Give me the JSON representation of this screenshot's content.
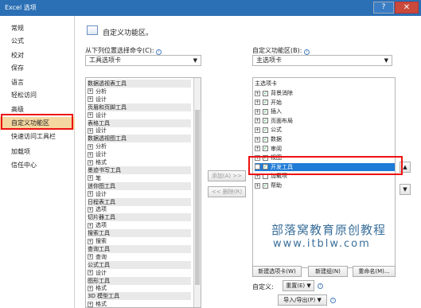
{
  "window": {
    "title": "Excel 选项",
    "help": "?",
    "close": "✕"
  },
  "sidebar": {
    "items": [
      {
        "label": "常规"
      },
      {
        "label": "公式"
      },
      {
        "label": "校对"
      },
      {
        "label": "保存"
      },
      {
        "label": "语言"
      },
      {
        "label": "轻松访问"
      },
      {
        "label": "高级"
      },
      {
        "label": "自定义功能区"
      },
      {
        "label": "快速访问工具栏"
      },
      {
        "label": "加载项"
      },
      {
        "label": "信任中心"
      }
    ],
    "selected": "自定义功能区"
  },
  "main": {
    "title": "自定义功能区。",
    "left_label": "从下列位置选择命令(C):",
    "left_combo": "工具选项卡",
    "right_label": "自定义功能区(B):",
    "right_combo": "主选项卡",
    "left_list": [
      {
        "text": "数据透视表工具",
        "group": true
      },
      {
        "text": "分析",
        "pm": "⊞"
      },
      {
        "text": "设计",
        "pm": "⊞"
      },
      {
        "text": "页眉和页脚工具",
        "group": true
      },
      {
        "text": "设计",
        "pm": "⊞"
      },
      {
        "text": "表格工具",
        "group": true
      },
      {
        "text": "设计",
        "pm": "⊞"
      },
      {
        "text": "数据透视图工具",
        "group": true
      },
      {
        "text": "分析",
        "pm": "⊞"
      },
      {
        "text": "设计",
        "pm": "⊞"
      },
      {
        "text": "格式",
        "pm": "⊞"
      },
      {
        "text": "墨迹书写工具",
        "group": true
      },
      {
        "text": "笔",
        "pm": "⊞"
      },
      {
        "text": "迷你图工具",
        "group": true
      },
      {
        "text": "设计",
        "pm": "⊞"
      },
      {
        "text": "日程表工具",
        "group": true
      },
      {
        "text": "选项",
        "pm": "⊞"
      },
      {
        "text": "切片器工具",
        "group": true
      },
      {
        "text": "选项",
        "pm": "⊞"
      },
      {
        "text": "搜索工具",
        "group": true
      },
      {
        "text": "搜索",
        "pm": "⊞"
      },
      {
        "text": "查询工具",
        "group": true
      },
      {
        "text": "查询",
        "pm": "⊞"
      },
      {
        "text": "公式工具",
        "group": true
      },
      {
        "text": "设计",
        "pm": "⊞"
      },
      {
        "text": "图形工具",
        "group": true
      },
      {
        "text": "格式",
        "pm": "⊞"
      },
      {
        "text": "3D 模型工具",
        "group": true
      },
      {
        "text": "格式",
        "pm": "⊞"
      }
    ],
    "right_list_header": "主选项卡",
    "right_list": [
      {
        "text": "背景消除",
        "checked": true
      },
      {
        "text": "开始",
        "checked": true
      },
      {
        "text": "插入",
        "checked": true
      },
      {
        "text": "页面布局",
        "checked": true
      },
      {
        "text": "公式",
        "checked": true
      },
      {
        "text": "数据",
        "checked": true
      },
      {
        "text": "审阅",
        "checked": true
      },
      {
        "text": "视图",
        "checked": true
      },
      {
        "text": "开发工具",
        "checked": true,
        "highlighted": true
      },
      {
        "text": "加载项",
        "checked": false
      },
      {
        "text": "帮助",
        "checked": true
      }
    ],
    "add_button": "添加(A) >>",
    "remove_button": "<< 删除(R)",
    "move_up": "▲",
    "move_down": "▼",
    "new_tab_button": "新建选项卡(W)",
    "new_group_button": "新建组(N)",
    "rename_button": "重命名(M)...",
    "customize_label": "自定义:",
    "reset_button": "重置(E) ▼",
    "import_export_button": "导入/导出(P) ▼",
    "watermark_line1": "部落窝教育原创教程",
    "watermark_line2": "www.itblw.com"
  }
}
